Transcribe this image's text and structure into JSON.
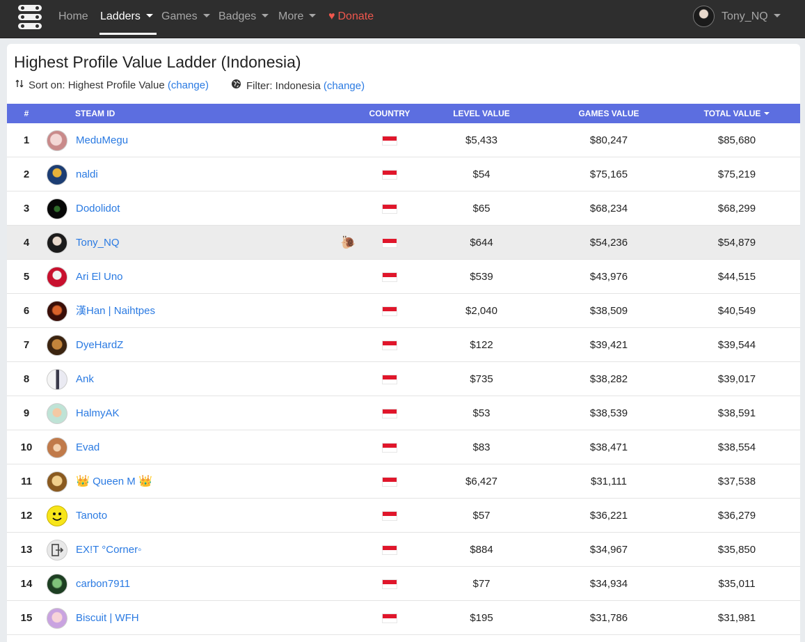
{
  "nav": {
    "home": "Home",
    "ladders": "Ladders",
    "games": "Games",
    "badges": "Badges",
    "more": "More",
    "donate": "Donate",
    "user": "Tony_NQ"
  },
  "page": {
    "title": "Highest Profile Value Ladder (Indonesia)",
    "sort_label": "Sort on: Highest Profile Value",
    "sort_change": "(change)",
    "filter_label": "Filter: Indonesia",
    "filter_change": "(change)"
  },
  "table": {
    "headers": {
      "rank": "#",
      "steam_id": "STEAM ID",
      "country": "COUNTRY",
      "level_value": "LEVEL VALUE",
      "games_value": "GAMES VALUE",
      "total_value": "TOTAL VALUE"
    },
    "rows": [
      {
        "rank": "1",
        "name": "MeduMegu",
        "level": "$5,433",
        "games": "$80,247",
        "total": "$85,680"
      },
      {
        "rank": "2",
        "name": "naldi",
        "level": "$54",
        "games": "$75,165",
        "total": "$75,219"
      },
      {
        "rank": "3",
        "name": "Dodolidot",
        "level": "$65",
        "games": "$68,234",
        "total": "$68,299"
      },
      {
        "rank": "4",
        "name": "Tony_NQ",
        "level": "$644",
        "games": "$54,236",
        "total": "$54,879"
      },
      {
        "rank": "5",
        "name": "Ari El Uno",
        "level": "$539",
        "games": "$43,976",
        "total": "$44,515"
      },
      {
        "rank": "6",
        "name": "漢Han | Naihtpes",
        "level": "$2,040",
        "games": "$38,509",
        "total": "$40,549"
      },
      {
        "rank": "7",
        "name": "DyeHardZ",
        "level": "$122",
        "games": "$39,421",
        "total": "$39,544"
      },
      {
        "rank": "8",
        "name": "Ank",
        "level": "$735",
        "games": "$38,282",
        "total": "$39,017"
      },
      {
        "rank": "9",
        "name": "HalmyAK",
        "level": "$53",
        "games": "$38,539",
        "total": "$38,591"
      },
      {
        "rank": "10",
        "name": "Evad",
        "level": "$83",
        "games": "$38,471",
        "total": "$38,554"
      },
      {
        "rank": "11",
        "name": "Queen M",
        "level": "$6,427",
        "games": "$31,111",
        "total": "$37,538"
      },
      {
        "rank": "12",
        "name": "Tanoto",
        "level": "$57",
        "games": "$36,221",
        "total": "$36,279"
      },
      {
        "rank": "13",
        "name": "EX!T °Corner◦",
        "level": "$884",
        "games": "$34,967",
        "total": "$35,850"
      },
      {
        "rank": "14",
        "name": "carbon7911",
        "level": "$77",
        "games": "$34,934",
        "total": "$35,011"
      },
      {
        "rank": "15",
        "name": "Biscuit | WFH",
        "level": "$195",
        "games": "$31,786",
        "total": "$31,981"
      }
    ]
  },
  "icons": {
    "crown": "👑",
    "snail": "🐌"
  },
  "colors": {
    "navbar": "#2e2e2e",
    "header_row": "#5c6ee0",
    "link": "#2a7ae2",
    "donate": "#f0574d",
    "highlight_row": "#ececec",
    "flag_red": "#e0162b"
  }
}
